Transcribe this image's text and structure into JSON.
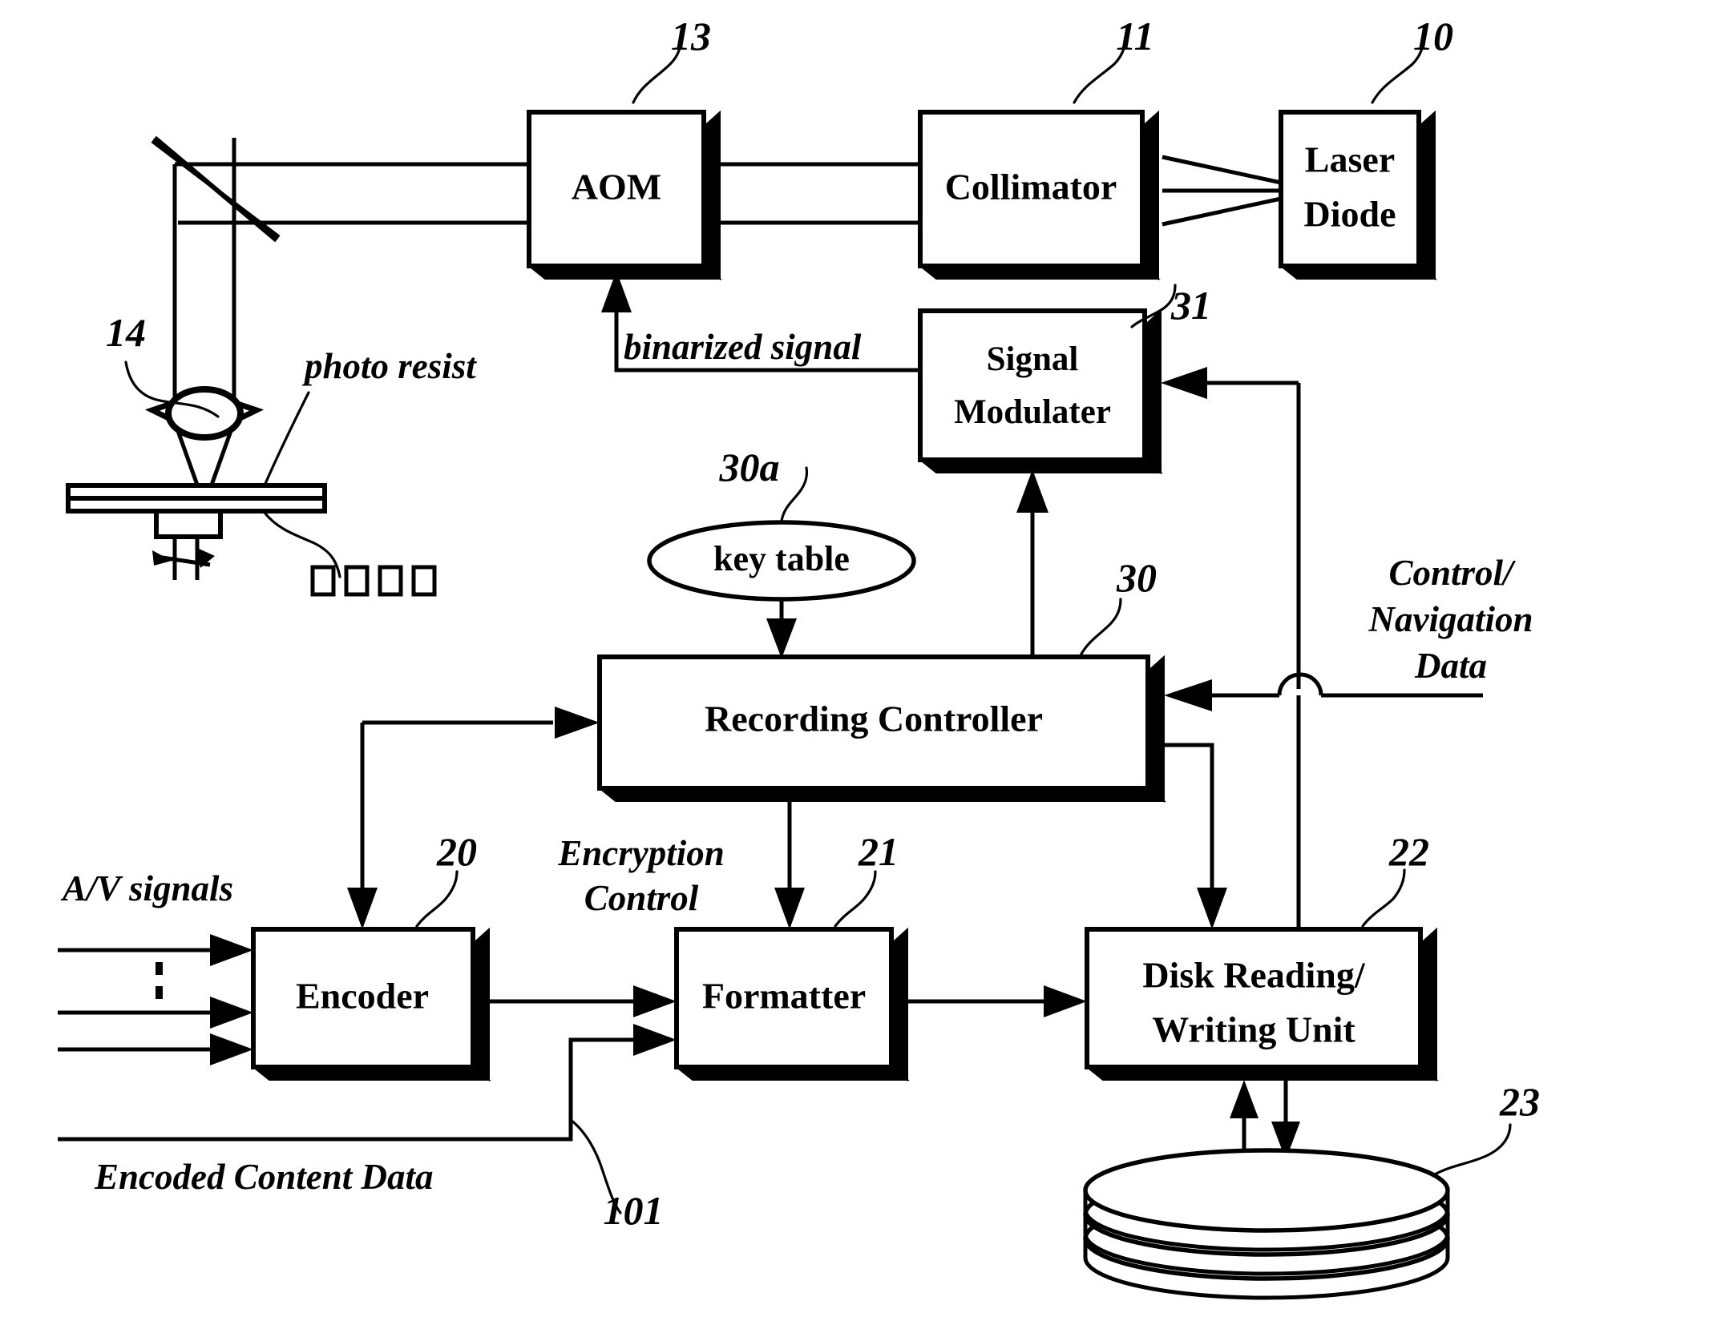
{
  "figure": {
    "type": "patent-block-diagram",
    "title": "Optical disc mastering and recording apparatus block diagram"
  },
  "blocks": [
    {
      "id": "aom",
      "label": "AOM",
      "ref": "13"
    },
    {
      "id": "collimator",
      "label": "Collimator",
      "ref": "11"
    },
    {
      "id": "laserdiode",
      "label_line1": "Laser",
      "label_line2": "Diode",
      "ref": "10"
    },
    {
      "id": "sigmod",
      "label_line1": "Signal",
      "label_line2": "Modulater",
      "ref": "31"
    },
    {
      "id": "reccontrol",
      "label": "Recording Controller",
      "ref": "30"
    },
    {
      "id": "encoder",
      "label": "Encoder",
      "ref": "20"
    },
    {
      "id": "formatter",
      "label": "Formatter",
      "ref": "21"
    },
    {
      "id": "diskunit",
      "label_line1": "Disk Reading/",
      "label_line2": "Writing Unit",
      "ref": "22"
    }
  ],
  "ellipse": {
    "id": "keytable",
    "label": "key table",
    "ref": "30a"
  },
  "optics": {
    "lens_ref": "14",
    "photoresist_label": "photo resist"
  },
  "disk": {
    "ref": "23"
  },
  "annotations": {
    "binarized_signal": "binarized signal",
    "control_navigation": {
      "line1": "Control/",
      "line2": "Navigation",
      "line3": "Data"
    },
    "encryption_control": {
      "line1": "Encryption",
      "line2": "Control"
    },
    "av_signals": "A/V signals",
    "encoded_content_data": "Encoded Content Data",
    "ref_101": "101"
  },
  "colors": {
    "ink": "#000000",
    "paper": "#ffffff"
  }
}
